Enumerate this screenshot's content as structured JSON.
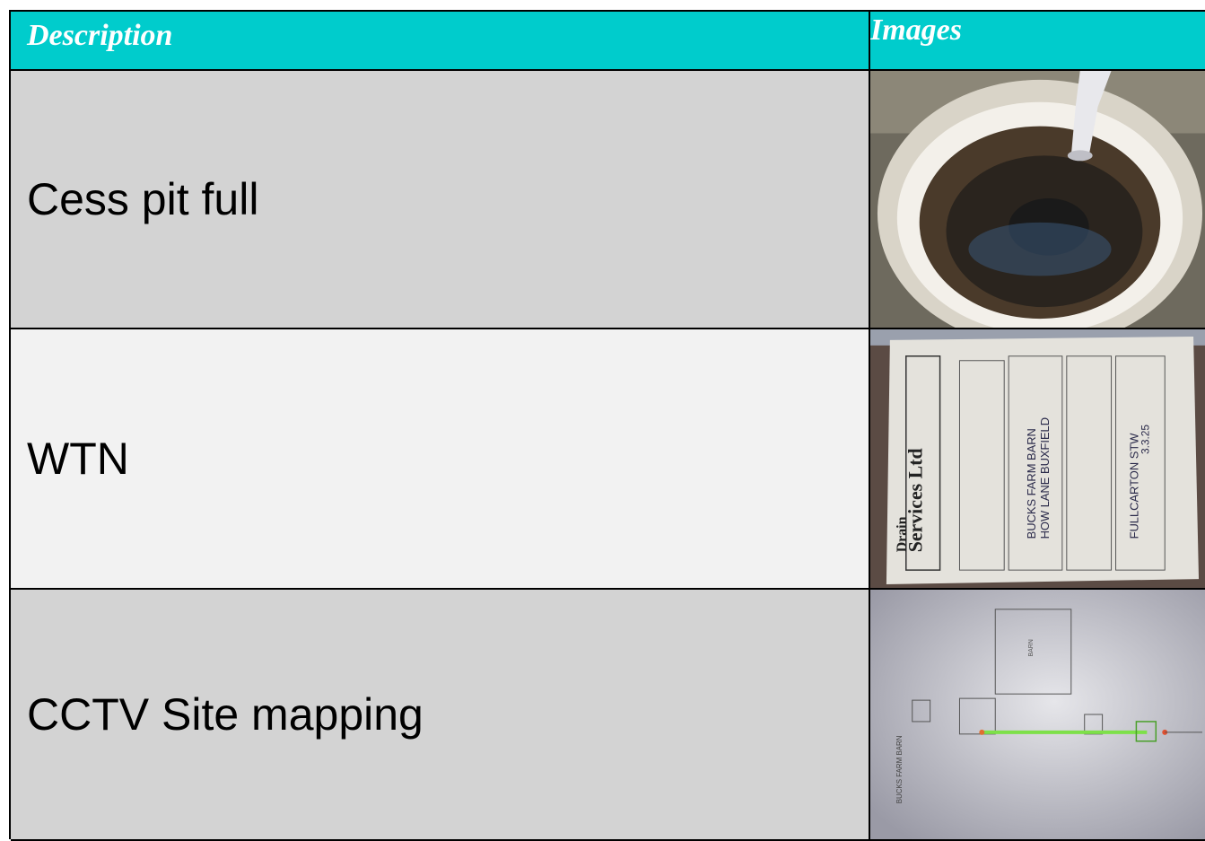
{
  "table": {
    "headers": {
      "description": "Description",
      "images": "Images"
    },
    "rows": [
      {
        "description": "Cess pit full",
        "image": "cess-pit-photo"
      },
      {
        "description": "WTN",
        "image": "waste-transfer-note-photo"
      },
      {
        "description": "CCTV Site mapping",
        "image": "site-map-sketch-photo"
      }
    ]
  },
  "wtn_photo": {
    "company_line1": "Drain",
    "company_line2": "Services Ltd",
    "handwritten": [
      "BUCKS FARM BARN",
      "HOW LANE BUXFIELD",
      "FULLCARTON STW",
      "3.3.25"
    ]
  },
  "site_map": {
    "labels": [
      "BARN",
      "BUCKS FARM BARN"
    ]
  },
  "colors": {
    "header_bg": "#00CCCC",
    "row_dark": "#d3d3d3",
    "row_light": "#f2f2f2"
  }
}
